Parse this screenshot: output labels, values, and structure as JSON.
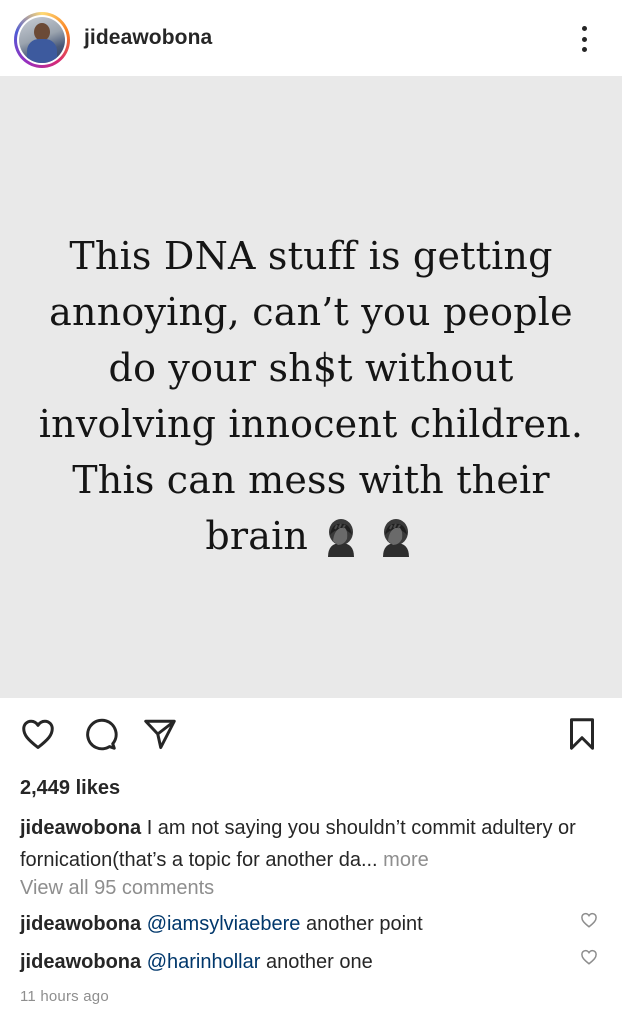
{
  "header": {
    "username": "jideawobona",
    "avatar_icon": "avatar",
    "more_icon": "more-vertical-icon"
  },
  "post": {
    "background_color": "#e9e9e9",
    "quote_lines": [
      "This DNA stuff is getting",
      "annoying, can’t you people",
      "do your sh$t without",
      "involving innocent children.",
      "This can mess with their"
    ],
    "quote_last_line": "brain",
    "emojis": [
      "facepalm-emoji",
      "facepalm-emoji"
    ]
  },
  "actions": {
    "like_icon": "heart-icon",
    "comment_icon": "comment-icon",
    "share_icon": "send-icon",
    "save_icon": "bookmark-icon"
  },
  "likes": "2,449 likes",
  "caption": {
    "username": "jideawobona",
    "text": "I am not saying you shouldn’t commit adultery or fornication(that’s a topic for another da...",
    "more_label": " more"
  },
  "view_all_comments": "View all 95 comments",
  "comments": [
    {
      "username": "jideawobona",
      "mention": "@iamsylviaebere",
      "text": " another point"
    },
    {
      "username": "jideawobona",
      "mention": "@harinhollar",
      "text": " another one"
    }
  ],
  "timestamp": "11 hours ago",
  "colors": {
    "text": "#262626",
    "muted": "#8e8e8e",
    "mention": "#00376b"
  }
}
